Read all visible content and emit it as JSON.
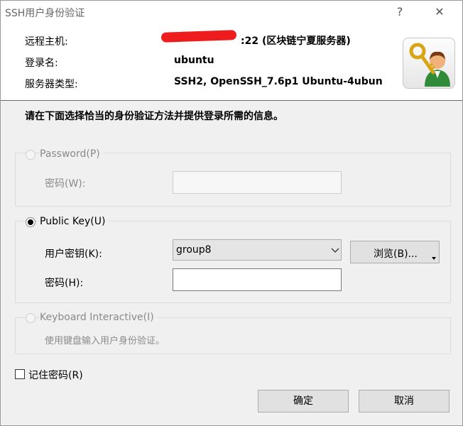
{
  "window": {
    "title": "SSH用户身份验证",
    "help_glyph": "?",
    "close_glyph": "✕"
  },
  "info": {
    "remote_host_label": "远程主机:",
    "remote_host_value": ":22 (区块链宁夏服务器)",
    "login_label": "登录名:",
    "login_value": "ubuntu",
    "server_type_label": "服务器类型:",
    "server_type_value": "SSH2, OpenSSH_7.6p1 Ubuntu-4ubuntu"
  },
  "instruction": "请在下面选择恰当的身份验证方法并提供登录所需的信息。",
  "password_section": {
    "option_label": "Password(P)",
    "password_label": "密码(W):",
    "password_value": ""
  },
  "publickey_section": {
    "option_label": "Public Key(U)",
    "user_key_label": "用户密钥(K):",
    "user_key_value": "group8",
    "browse_label": "浏览(B)...",
    "passphrase_label": "密码(H):",
    "passphrase_value": ""
  },
  "keyboard_section": {
    "option_label": "Keyboard Interactive(I)",
    "hint": "使用键盘输入用户身份验证。"
  },
  "remember": {
    "label": "记住密码(R)"
  },
  "buttons": {
    "ok": "确定",
    "cancel": "取消"
  },
  "colors": {
    "redaction": "#ee1c1c"
  },
  "icons": [
    "help-icon",
    "close-icon",
    "key-user-icon",
    "dropdown-chevron-icon",
    "browse-menu-arrow-icon"
  ]
}
